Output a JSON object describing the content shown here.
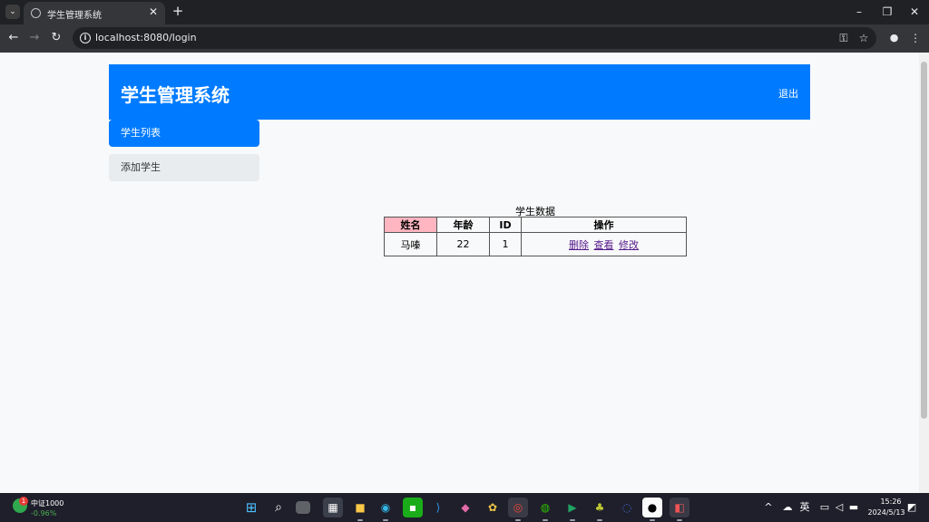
{
  "browser": {
    "tab_title": "学生管理系统",
    "url": "localhost:8080/login",
    "window_controls": {
      "minimize": "–",
      "restore": "❐",
      "close": "✕"
    },
    "new_tab_label": "+",
    "tab_close_label": "✕"
  },
  "page": {
    "site_title": "学生管理系统",
    "logout_label": "退出",
    "sidebar": [
      {
        "label": "学生列表",
        "active": true
      },
      {
        "label": "添加学生",
        "active": false
      }
    ],
    "table": {
      "caption": "学生数据",
      "headers": [
        "姓名",
        "年龄",
        "ID",
        "操作"
      ],
      "rows": [
        {
          "name": "马嗪",
          "age": "22",
          "id": "1",
          "actions": [
            "删除",
            "查看",
            "修改"
          ]
        }
      ]
    }
  },
  "taskbar": {
    "stock_name": "中证1000",
    "stock_change": "-0.96%",
    "stock_badge": "1",
    "ime_label": "英",
    "time": "15:26",
    "date": "2024/5/13"
  },
  "colors": {
    "header_bg": "#007bff",
    "active_sidebar_bg": "#007bff",
    "name_header_bg": "#ffb6c1",
    "stock_change": "#4caf50"
  }
}
